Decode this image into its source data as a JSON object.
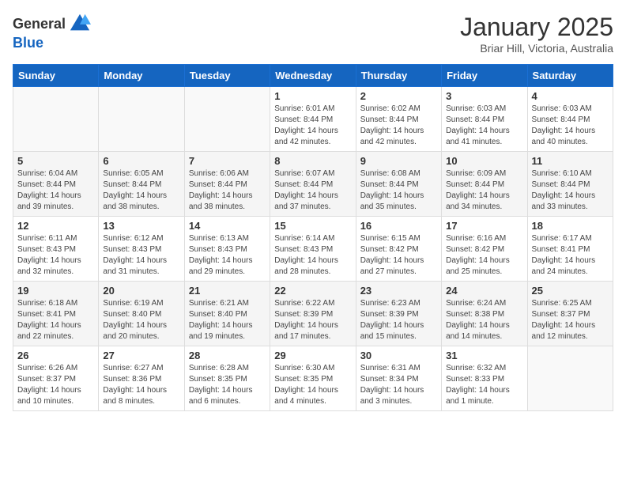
{
  "header": {
    "logo_general": "General",
    "logo_blue": "Blue",
    "month_title": "January 2025",
    "subtitle": "Briar Hill, Victoria, Australia"
  },
  "weekdays": [
    "Sunday",
    "Monday",
    "Tuesday",
    "Wednesday",
    "Thursday",
    "Friday",
    "Saturday"
  ],
  "weeks": [
    [
      {
        "day": "",
        "info": ""
      },
      {
        "day": "",
        "info": ""
      },
      {
        "day": "",
        "info": ""
      },
      {
        "day": "1",
        "info": "Sunrise: 6:01 AM\nSunset: 8:44 PM\nDaylight: 14 hours\nand 42 minutes."
      },
      {
        "day": "2",
        "info": "Sunrise: 6:02 AM\nSunset: 8:44 PM\nDaylight: 14 hours\nand 42 minutes."
      },
      {
        "day": "3",
        "info": "Sunrise: 6:03 AM\nSunset: 8:44 PM\nDaylight: 14 hours\nand 41 minutes."
      },
      {
        "day": "4",
        "info": "Sunrise: 6:03 AM\nSunset: 8:44 PM\nDaylight: 14 hours\nand 40 minutes."
      }
    ],
    [
      {
        "day": "5",
        "info": "Sunrise: 6:04 AM\nSunset: 8:44 PM\nDaylight: 14 hours\nand 39 minutes."
      },
      {
        "day": "6",
        "info": "Sunrise: 6:05 AM\nSunset: 8:44 PM\nDaylight: 14 hours\nand 38 minutes."
      },
      {
        "day": "7",
        "info": "Sunrise: 6:06 AM\nSunset: 8:44 PM\nDaylight: 14 hours\nand 38 minutes."
      },
      {
        "day": "8",
        "info": "Sunrise: 6:07 AM\nSunset: 8:44 PM\nDaylight: 14 hours\nand 37 minutes."
      },
      {
        "day": "9",
        "info": "Sunrise: 6:08 AM\nSunset: 8:44 PM\nDaylight: 14 hours\nand 35 minutes."
      },
      {
        "day": "10",
        "info": "Sunrise: 6:09 AM\nSunset: 8:44 PM\nDaylight: 14 hours\nand 34 minutes."
      },
      {
        "day": "11",
        "info": "Sunrise: 6:10 AM\nSunset: 8:44 PM\nDaylight: 14 hours\nand 33 minutes."
      }
    ],
    [
      {
        "day": "12",
        "info": "Sunrise: 6:11 AM\nSunset: 8:43 PM\nDaylight: 14 hours\nand 32 minutes."
      },
      {
        "day": "13",
        "info": "Sunrise: 6:12 AM\nSunset: 8:43 PM\nDaylight: 14 hours\nand 31 minutes."
      },
      {
        "day": "14",
        "info": "Sunrise: 6:13 AM\nSunset: 8:43 PM\nDaylight: 14 hours\nand 29 minutes."
      },
      {
        "day": "15",
        "info": "Sunrise: 6:14 AM\nSunset: 8:43 PM\nDaylight: 14 hours\nand 28 minutes."
      },
      {
        "day": "16",
        "info": "Sunrise: 6:15 AM\nSunset: 8:42 PM\nDaylight: 14 hours\nand 27 minutes."
      },
      {
        "day": "17",
        "info": "Sunrise: 6:16 AM\nSunset: 8:42 PM\nDaylight: 14 hours\nand 25 minutes."
      },
      {
        "day": "18",
        "info": "Sunrise: 6:17 AM\nSunset: 8:41 PM\nDaylight: 14 hours\nand 24 minutes."
      }
    ],
    [
      {
        "day": "19",
        "info": "Sunrise: 6:18 AM\nSunset: 8:41 PM\nDaylight: 14 hours\nand 22 minutes."
      },
      {
        "day": "20",
        "info": "Sunrise: 6:19 AM\nSunset: 8:40 PM\nDaylight: 14 hours\nand 20 minutes."
      },
      {
        "day": "21",
        "info": "Sunrise: 6:21 AM\nSunset: 8:40 PM\nDaylight: 14 hours\nand 19 minutes."
      },
      {
        "day": "22",
        "info": "Sunrise: 6:22 AM\nSunset: 8:39 PM\nDaylight: 14 hours\nand 17 minutes."
      },
      {
        "day": "23",
        "info": "Sunrise: 6:23 AM\nSunset: 8:39 PM\nDaylight: 14 hours\nand 15 minutes."
      },
      {
        "day": "24",
        "info": "Sunrise: 6:24 AM\nSunset: 8:38 PM\nDaylight: 14 hours\nand 14 minutes."
      },
      {
        "day": "25",
        "info": "Sunrise: 6:25 AM\nSunset: 8:37 PM\nDaylight: 14 hours\nand 12 minutes."
      }
    ],
    [
      {
        "day": "26",
        "info": "Sunrise: 6:26 AM\nSunset: 8:37 PM\nDaylight: 14 hours\nand 10 minutes."
      },
      {
        "day": "27",
        "info": "Sunrise: 6:27 AM\nSunset: 8:36 PM\nDaylight: 14 hours\nand 8 minutes."
      },
      {
        "day": "28",
        "info": "Sunrise: 6:28 AM\nSunset: 8:35 PM\nDaylight: 14 hours\nand 6 minutes."
      },
      {
        "day": "29",
        "info": "Sunrise: 6:30 AM\nSunset: 8:35 PM\nDaylight: 14 hours\nand 4 minutes."
      },
      {
        "day": "30",
        "info": "Sunrise: 6:31 AM\nSunset: 8:34 PM\nDaylight: 14 hours\nand 3 minutes."
      },
      {
        "day": "31",
        "info": "Sunrise: 6:32 AM\nSunset: 8:33 PM\nDaylight: 14 hours\nand 1 minute."
      },
      {
        "day": "",
        "info": ""
      }
    ]
  ]
}
